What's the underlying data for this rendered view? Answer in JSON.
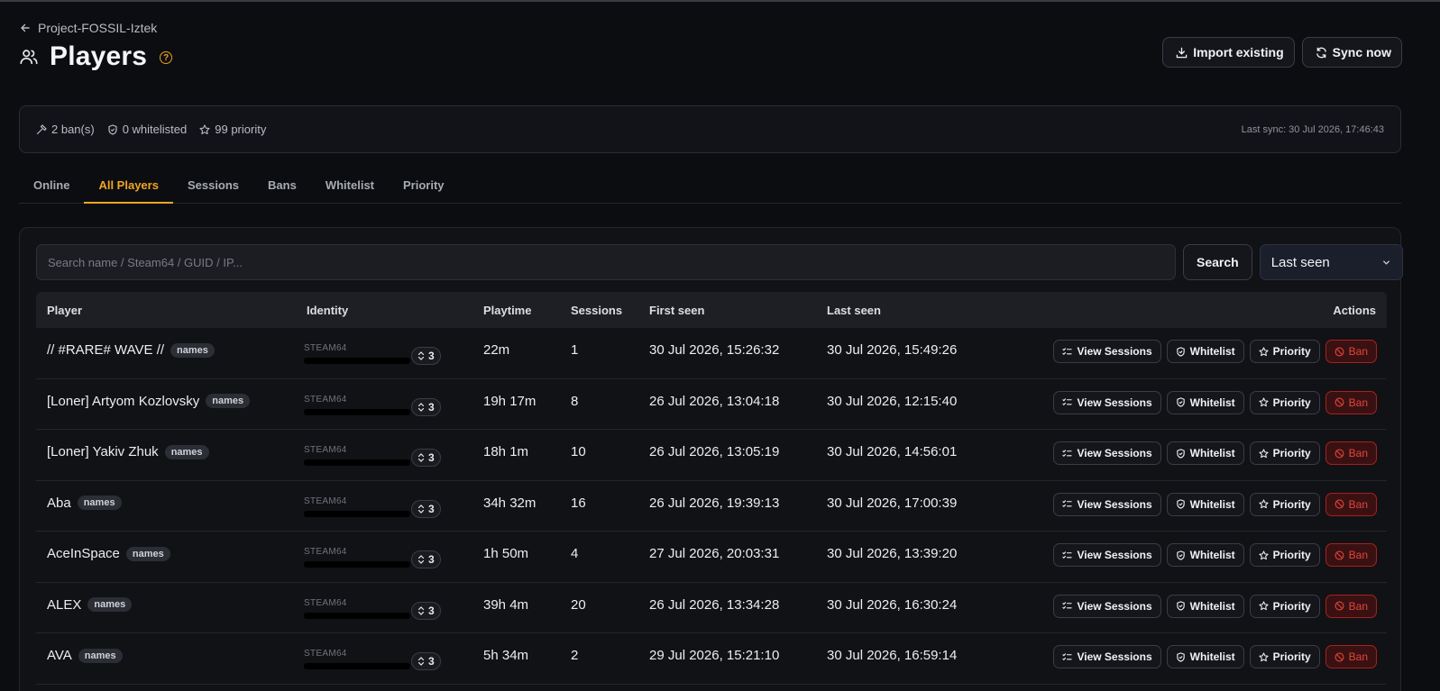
{
  "header": {
    "back_label": "Project-FOSSIL-Iztek",
    "title": "Players",
    "help_symbol": "?",
    "import_label": "Import existing",
    "sync_label": "Sync now"
  },
  "summary": {
    "bans": "2 ban(s)",
    "whitelisted": "0 whitelisted",
    "priority": "99 priority",
    "last_sync": "Last sync: 30 Jul 2026, 17:46:43"
  },
  "tabs": [
    "Online",
    "All Players",
    "Sessions",
    "Bans",
    "Whitelist",
    "Priority"
  ],
  "active_tab": "All Players",
  "search": {
    "placeholder": "Search name / Steam64 / GUID / IP...",
    "button_label": "Search",
    "sort_value": "Last seen"
  },
  "table": {
    "columns": {
      "player": "Player",
      "identity": "Identity",
      "playtime": "Playtime",
      "sessions": "Sessions",
      "first_seen": "First seen",
      "last_seen": "Last seen",
      "actions": "Actions"
    },
    "badge_label": "names",
    "identity_label": "STEAM64",
    "action_labels": {
      "view_sessions": "View Sessions",
      "whitelist": "Whitelist",
      "priority": "Priority",
      "ban": "Ban"
    },
    "rows": [
      {
        "name": "// #RARE# WAVE //",
        "ids": "3",
        "playtime": "22m",
        "sessions": "1",
        "first_seen": "30 Jul 2026, 15:26:32",
        "last_seen": "30 Jul 2026, 15:49:26"
      },
      {
        "name": "[Loner] Artyom Kozlovsky",
        "ids": "3",
        "playtime": "19h 17m",
        "sessions": "8",
        "first_seen": "26 Jul 2026, 13:04:18",
        "last_seen": "30 Jul 2026, 12:15:40"
      },
      {
        "name": "[Loner] Yakiv Zhuk",
        "ids": "3",
        "playtime": "18h 1m",
        "sessions": "10",
        "first_seen": "26 Jul 2026, 13:05:19",
        "last_seen": "30 Jul 2026, 14:56:01"
      },
      {
        "name": "Aba",
        "ids": "3",
        "playtime": "34h 32m",
        "sessions": "16",
        "first_seen": "26 Jul 2026, 19:39:13",
        "last_seen": "30 Jul 2026, 17:00:39"
      },
      {
        "name": "AceInSpace",
        "ids": "3",
        "playtime": "1h 50m",
        "sessions": "4",
        "first_seen": "27 Jul 2026, 20:03:31",
        "last_seen": "30 Jul 2026, 13:39:20"
      },
      {
        "name": "ALEX",
        "ids": "3",
        "playtime": "39h 4m",
        "sessions": "20",
        "first_seen": "26 Jul 2026, 13:34:28",
        "last_seen": "30 Jul 2026, 16:30:24"
      },
      {
        "name": "AVA",
        "ids": "3",
        "playtime": "5h 34m",
        "sessions": "2",
        "first_seen": "29 Jul 2026, 15:21:10",
        "last_seen": "30 Jul 2026, 16:59:14"
      }
    ]
  }
}
